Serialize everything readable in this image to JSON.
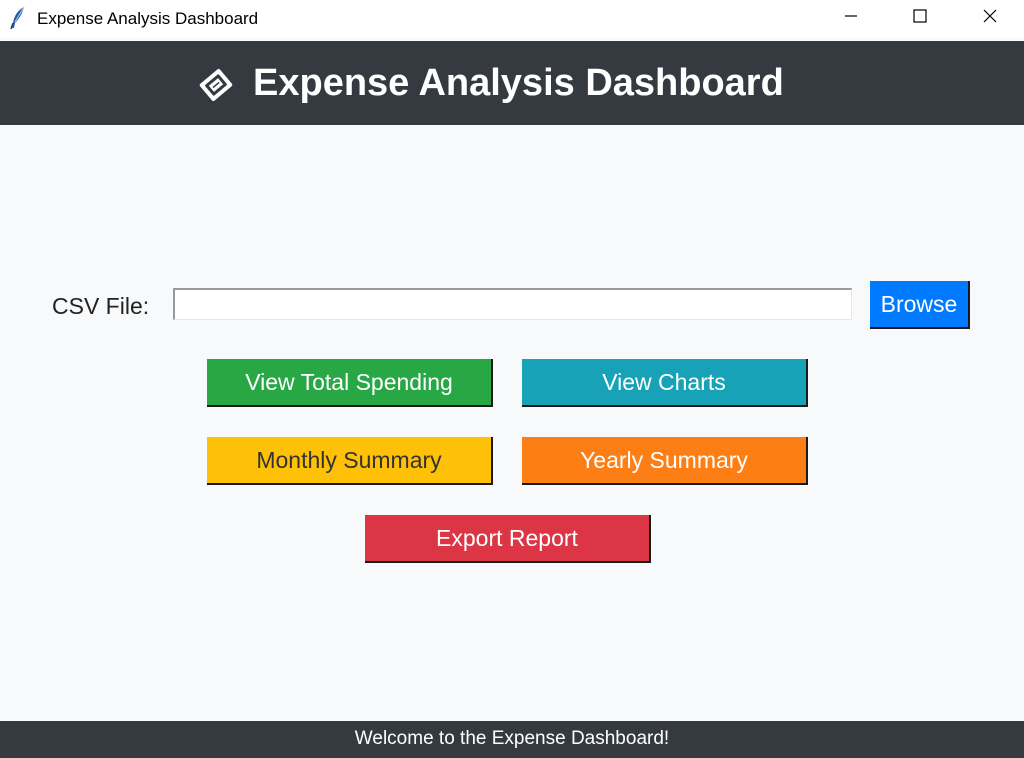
{
  "window": {
    "title": "Expense Analysis Dashboard",
    "app_icon": "feather-icon"
  },
  "header": {
    "title": "Expense Analysis Dashboard",
    "icon": "receipt-tag-icon",
    "background": "#343a40"
  },
  "csv": {
    "label": "CSV File:",
    "value": "",
    "browse_label": "Browse",
    "browse_color": "#007bff"
  },
  "actions": {
    "total_spending": {
      "label": "View Total Spending",
      "color": "#28a745"
    },
    "charts": {
      "label": "View Charts",
      "color": "#17a2b8"
    },
    "monthly_summary": {
      "label": "Monthly Summary",
      "color": "#ffc107"
    },
    "yearly_summary": {
      "label": "Yearly Summary",
      "color": "#fd7e14"
    },
    "export_report": {
      "label": "Export Report",
      "color": "#dc3545"
    }
  },
  "status": {
    "message": "Welcome to the Expense Dashboard!"
  }
}
